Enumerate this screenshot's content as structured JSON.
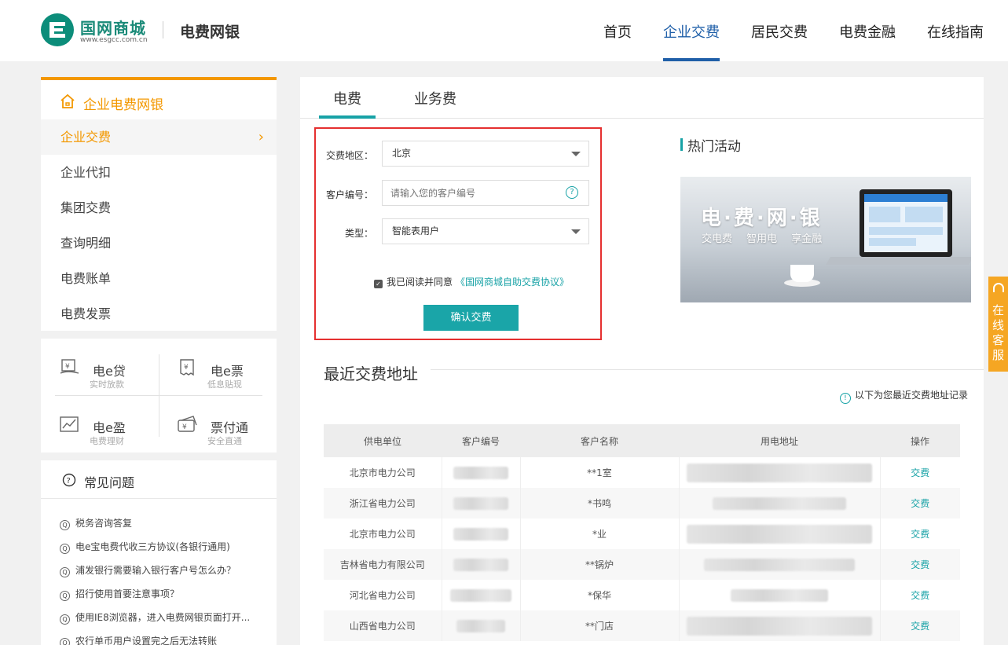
{
  "header": {
    "brand": "国网商城",
    "brand_url": "www.esgcc.com.cn",
    "product": "电费网银",
    "nav": [
      "首页",
      "企业交费",
      "居民交费",
      "电费金融",
      "在线指南"
    ],
    "active_nav": "企业交费"
  },
  "sidebar": {
    "title": "企业电费网银",
    "items": [
      "企业交费",
      "企业代扣",
      "集团交费",
      "查询明细",
      "电费账单",
      "电费发票"
    ],
    "active_item": "企业交费"
  },
  "products": [
    {
      "name": "电e贷",
      "sub": "实时放款",
      "icon": "e-loan-icon"
    },
    {
      "name": "电e票",
      "sub": "低息贴现",
      "icon": "e-bill-icon"
    },
    {
      "name": "电e盈",
      "sub": "电费理财",
      "icon": "chart-icon"
    },
    {
      "name": "票付通",
      "sub": "安全直通",
      "icon": "ticket-pay-icon"
    }
  ],
  "faq": {
    "title": "常见问题",
    "items": [
      "税务咨询答复",
      "电e宝电费代收三方协议(各银行通用)",
      "浦发银行需要输入银行客户号怎么办？",
      "招行使用首要注意事项？",
      "使用IE8浏览器，进入电费网银页面打开...",
      "农行单币用户设置完之后无法转账"
    ]
  },
  "tabs": [
    "电费",
    "业务费"
  ],
  "active_tab": "电费",
  "form": {
    "region_label": "交费地区：",
    "region_value": "北京",
    "customer_label": "客户编号：",
    "customer_placeholder": "请输入您的客户编号",
    "type_label": "类型：",
    "type_value": "智能表用户",
    "agree_text": "我已阅读并同意",
    "agree_link": "《国网商城自助交费协议》",
    "submit": "确认交费",
    "help": "?",
    "checked": true
  },
  "hot": {
    "title": "热门活动",
    "banner_title": "电·费·网·银",
    "banner_sub": "交电费 智用电 享金融"
  },
  "recent": {
    "title": "最近交费地址",
    "note": "以下为您最近交费地址记录",
    "headers": [
      "供电单位",
      "客户编号",
      "客户名称",
      "用电地址",
      "操作"
    ],
    "rows": [
      {
        "unit": "北京市电力公司",
        "name": "**1室",
        "action": "交费"
      },
      {
        "unit": "浙江省电力公司",
        "name": "*书鸣",
        "action": "交费"
      },
      {
        "unit": "北京市电力公司",
        "name": "*业",
        "action": "交费"
      },
      {
        "unit": "吉林省电力有限公司",
        "name": "**锅炉",
        "action": "交费"
      },
      {
        "unit": "河北省电力公司",
        "name": "*保华",
        "action": "交费"
      },
      {
        "unit": "山西省电力公司",
        "name": "**门店",
        "action": "交费"
      }
    ]
  },
  "float_service": "在线客服",
  "colors": {
    "accent_orange": "#f39800",
    "accent_teal": "#17a2a6",
    "nav_blue": "#1f5fa8",
    "highlight_red": "#e53030"
  }
}
